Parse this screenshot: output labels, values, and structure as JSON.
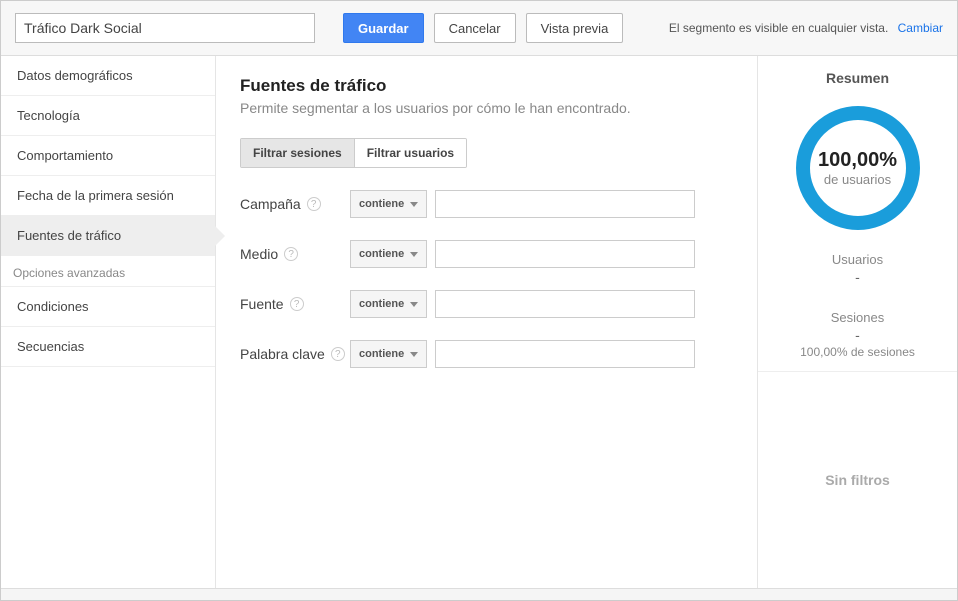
{
  "header": {
    "segment_name": "Tráfico Dark Social",
    "save": "Guardar",
    "cancel": "Cancelar",
    "preview": "Vista previa",
    "visibility_text": "El segmento es visible en cualquier vista.",
    "change": "Cambiar"
  },
  "sidebar": {
    "items": [
      {
        "id": "demographics",
        "label": "Datos demográficos"
      },
      {
        "id": "technology",
        "label": "Tecnología"
      },
      {
        "id": "behavior",
        "label": "Comportamiento"
      },
      {
        "id": "first-session-date",
        "label": "Fecha de la primera sesión"
      },
      {
        "id": "traffic-sources",
        "label": "Fuentes de tráfico"
      }
    ],
    "advanced_label": "Opciones avanzadas",
    "advanced_items": [
      {
        "id": "conditions",
        "label": "Condiciones"
      },
      {
        "id": "sequences",
        "label": "Secuencias"
      }
    ],
    "active_id": "traffic-sources"
  },
  "main": {
    "title": "Fuentes de tráfico",
    "description": "Permite segmentar a los usuarios por cómo le han encontrado.",
    "filter_sessions": "Filtrar sesiones",
    "filter_users": "Filtrar usuarios",
    "fields": [
      {
        "id": "campaign",
        "label": "Campaña",
        "operator": "contiene",
        "value": ""
      },
      {
        "id": "medium",
        "label": "Medio",
        "operator": "contiene",
        "value": ""
      },
      {
        "id": "source",
        "label": "Fuente",
        "operator": "contiene",
        "value": ""
      },
      {
        "id": "keyword",
        "label": "Palabra clave",
        "operator": "contiene",
        "value": ""
      }
    ]
  },
  "summary": {
    "title": "Resumen",
    "percent": "100,00%",
    "percent_sub": "de usuarios",
    "users_label": "Usuarios",
    "users_value": "-",
    "sessions_label": "Sesiones",
    "sessions_value": "-",
    "sessions_pct": "100,00% de sesiones",
    "no_filters": "Sin filtros"
  },
  "colors": {
    "accent": "#1a9ddb"
  }
}
